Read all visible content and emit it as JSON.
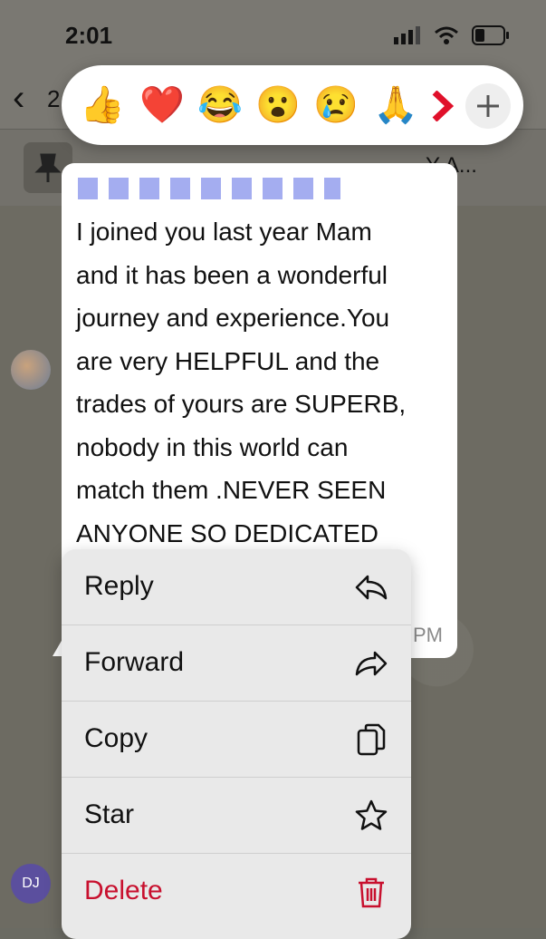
{
  "status": {
    "time": "2:01"
  },
  "header": {
    "back_count": "2"
  },
  "pinned": {
    "text": "Y A..."
  },
  "reactions": {
    "emojis": [
      "👍",
      "❤️",
      "😂",
      "😮",
      "😢",
      "🙏"
    ]
  },
  "message": {
    "lines": [
      "I joined you last year Mam",
      "and it has been a wonderful",
      "journey and experience.You",
      "are very HELPFUL and the",
      "trades of yours are SUPERB,",
      "nobody in this world can",
      "match them .NEVER SEEN",
      "ANYONE SO DEDICATED"
    ],
    "time_suffix": "PM"
  },
  "avatar_initials": "DJ",
  "menu": {
    "items": [
      {
        "label": "Reply",
        "icon": "reply-icon",
        "color": "#111111"
      },
      {
        "label": "Forward",
        "icon": "forward-icon",
        "color": "#111111"
      },
      {
        "label": "Copy",
        "icon": "copy-icon",
        "color": "#111111"
      },
      {
        "label": "Star",
        "icon": "star-icon",
        "color": "#111111"
      },
      {
        "label": "Delete",
        "icon": "trash-icon",
        "color": "#c8102e"
      }
    ]
  }
}
